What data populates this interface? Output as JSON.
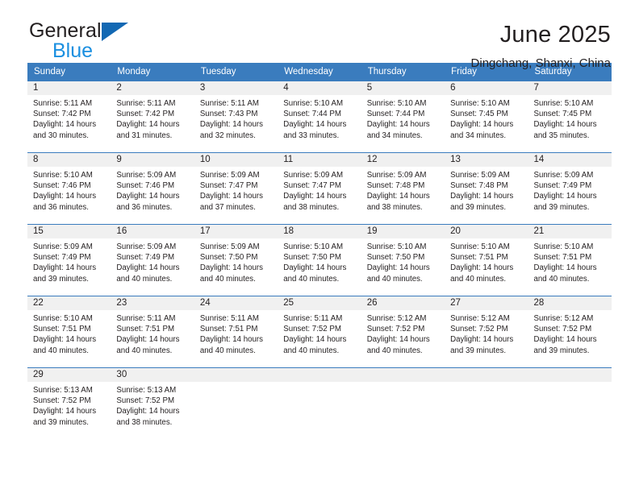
{
  "brand": {
    "name_top": "General",
    "name_bottom": "Blue",
    "triangle_color": "#1268b3",
    "blue_color": "#1a8fe0"
  },
  "header": {
    "title": "June 2025",
    "subtitle": "Dingchang, Shanxi, China"
  },
  "theme": {
    "header_blue": "#3a7cbe",
    "daynum_band": "#f0f0f0",
    "text": "#231f20"
  },
  "calendar": {
    "weekday_headers": [
      "Sunday",
      "Monday",
      "Tuesday",
      "Wednesday",
      "Thursday",
      "Friday",
      "Saturday"
    ],
    "labels": {
      "sunrise": "Sunrise:",
      "sunset": "Sunset:",
      "daylight": "Daylight:"
    },
    "weeks": [
      [
        {
          "day": "1",
          "sunrise": "Sunrise: 5:11 AM",
          "sunset": "Sunset: 7:42 PM",
          "daylight_1": "Daylight: 14 hours",
          "daylight_2": "and 30 minutes."
        },
        {
          "day": "2",
          "sunrise": "Sunrise: 5:11 AM",
          "sunset": "Sunset: 7:42 PM",
          "daylight_1": "Daylight: 14 hours",
          "daylight_2": "and 31 minutes."
        },
        {
          "day": "3",
          "sunrise": "Sunrise: 5:11 AM",
          "sunset": "Sunset: 7:43 PM",
          "daylight_1": "Daylight: 14 hours",
          "daylight_2": "and 32 minutes."
        },
        {
          "day": "4",
          "sunrise": "Sunrise: 5:10 AM",
          "sunset": "Sunset: 7:44 PM",
          "daylight_1": "Daylight: 14 hours",
          "daylight_2": "and 33 minutes."
        },
        {
          "day": "5",
          "sunrise": "Sunrise: 5:10 AM",
          "sunset": "Sunset: 7:44 PM",
          "daylight_1": "Daylight: 14 hours",
          "daylight_2": "and 34 minutes."
        },
        {
          "day": "6",
          "sunrise": "Sunrise: 5:10 AM",
          "sunset": "Sunset: 7:45 PM",
          "daylight_1": "Daylight: 14 hours",
          "daylight_2": "and 34 minutes."
        },
        {
          "day": "7",
          "sunrise": "Sunrise: 5:10 AM",
          "sunset": "Sunset: 7:45 PM",
          "daylight_1": "Daylight: 14 hours",
          "daylight_2": "and 35 minutes."
        }
      ],
      [
        {
          "day": "8",
          "sunrise": "Sunrise: 5:10 AM",
          "sunset": "Sunset: 7:46 PM",
          "daylight_1": "Daylight: 14 hours",
          "daylight_2": "and 36 minutes."
        },
        {
          "day": "9",
          "sunrise": "Sunrise: 5:09 AM",
          "sunset": "Sunset: 7:46 PM",
          "daylight_1": "Daylight: 14 hours",
          "daylight_2": "and 36 minutes."
        },
        {
          "day": "10",
          "sunrise": "Sunrise: 5:09 AM",
          "sunset": "Sunset: 7:47 PM",
          "daylight_1": "Daylight: 14 hours",
          "daylight_2": "and 37 minutes."
        },
        {
          "day": "11",
          "sunrise": "Sunrise: 5:09 AM",
          "sunset": "Sunset: 7:47 PM",
          "daylight_1": "Daylight: 14 hours",
          "daylight_2": "and 38 minutes."
        },
        {
          "day": "12",
          "sunrise": "Sunrise: 5:09 AM",
          "sunset": "Sunset: 7:48 PM",
          "daylight_1": "Daylight: 14 hours",
          "daylight_2": "and 38 minutes."
        },
        {
          "day": "13",
          "sunrise": "Sunrise: 5:09 AM",
          "sunset": "Sunset: 7:48 PM",
          "daylight_1": "Daylight: 14 hours",
          "daylight_2": "and 39 minutes."
        },
        {
          "day": "14",
          "sunrise": "Sunrise: 5:09 AM",
          "sunset": "Sunset: 7:49 PM",
          "daylight_1": "Daylight: 14 hours",
          "daylight_2": "and 39 minutes."
        }
      ],
      [
        {
          "day": "15",
          "sunrise": "Sunrise: 5:09 AM",
          "sunset": "Sunset: 7:49 PM",
          "daylight_1": "Daylight: 14 hours",
          "daylight_2": "and 39 minutes."
        },
        {
          "day": "16",
          "sunrise": "Sunrise: 5:09 AM",
          "sunset": "Sunset: 7:49 PM",
          "daylight_1": "Daylight: 14 hours",
          "daylight_2": "and 40 minutes."
        },
        {
          "day": "17",
          "sunrise": "Sunrise: 5:09 AM",
          "sunset": "Sunset: 7:50 PM",
          "daylight_1": "Daylight: 14 hours",
          "daylight_2": "and 40 minutes."
        },
        {
          "day": "18",
          "sunrise": "Sunrise: 5:10 AM",
          "sunset": "Sunset: 7:50 PM",
          "daylight_1": "Daylight: 14 hours",
          "daylight_2": "and 40 minutes."
        },
        {
          "day": "19",
          "sunrise": "Sunrise: 5:10 AM",
          "sunset": "Sunset: 7:50 PM",
          "daylight_1": "Daylight: 14 hours",
          "daylight_2": "and 40 minutes."
        },
        {
          "day": "20",
          "sunrise": "Sunrise: 5:10 AM",
          "sunset": "Sunset: 7:51 PM",
          "daylight_1": "Daylight: 14 hours",
          "daylight_2": "and 40 minutes."
        },
        {
          "day": "21",
          "sunrise": "Sunrise: 5:10 AM",
          "sunset": "Sunset: 7:51 PM",
          "daylight_1": "Daylight: 14 hours",
          "daylight_2": "and 40 minutes."
        }
      ],
      [
        {
          "day": "22",
          "sunrise": "Sunrise: 5:10 AM",
          "sunset": "Sunset: 7:51 PM",
          "daylight_1": "Daylight: 14 hours",
          "daylight_2": "and 40 minutes."
        },
        {
          "day": "23",
          "sunrise": "Sunrise: 5:11 AM",
          "sunset": "Sunset: 7:51 PM",
          "daylight_1": "Daylight: 14 hours",
          "daylight_2": "and 40 minutes."
        },
        {
          "day": "24",
          "sunrise": "Sunrise: 5:11 AM",
          "sunset": "Sunset: 7:51 PM",
          "daylight_1": "Daylight: 14 hours",
          "daylight_2": "and 40 minutes."
        },
        {
          "day": "25",
          "sunrise": "Sunrise: 5:11 AM",
          "sunset": "Sunset: 7:52 PM",
          "daylight_1": "Daylight: 14 hours",
          "daylight_2": "and 40 minutes."
        },
        {
          "day": "26",
          "sunrise": "Sunrise: 5:12 AM",
          "sunset": "Sunset: 7:52 PM",
          "daylight_1": "Daylight: 14 hours",
          "daylight_2": "and 40 minutes."
        },
        {
          "day": "27",
          "sunrise": "Sunrise: 5:12 AM",
          "sunset": "Sunset: 7:52 PM",
          "daylight_1": "Daylight: 14 hours",
          "daylight_2": "and 39 minutes."
        },
        {
          "day": "28",
          "sunrise": "Sunrise: 5:12 AM",
          "sunset": "Sunset: 7:52 PM",
          "daylight_1": "Daylight: 14 hours",
          "daylight_2": "and 39 minutes."
        }
      ],
      [
        {
          "day": "29",
          "sunrise": "Sunrise: 5:13 AM",
          "sunset": "Sunset: 7:52 PM",
          "daylight_1": "Daylight: 14 hours",
          "daylight_2": "and 39 minutes."
        },
        {
          "day": "30",
          "sunrise": "Sunrise: 5:13 AM",
          "sunset": "Sunset: 7:52 PM",
          "daylight_1": "Daylight: 14 hours",
          "daylight_2": "and 38 minutes."
        },
        {
          "day": "",
          "sunrise": "",
          "sunset": "",
          "daylight_1": "",
          "daylight_2": ""
        },
        {
          "day": "",
          "sunrise": "",
          "sunset": "",
          "daylight_1": "",
          "daylight_2": ""
        },
        {
          "day": "",
          "sunrise": "",
          "sunset": "",
          "daylight_1": "",
          "daylight_2": ""
        },
        {
          "day": "",
          "sunrise": "",
          "sunset": "",
          "daylight_1": "",
          "daylight_2": ""
        },
        {
          "day": "",
          "sunrise": "",
          "sunset": "",
          "daylight_1": "",
          "daylight_2": ""
        }
      ]
    ]
  }
}
